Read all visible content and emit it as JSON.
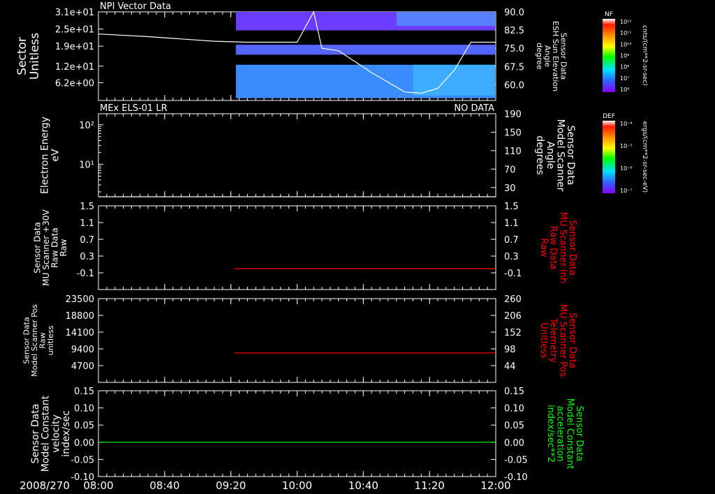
{
  "theme": {
    "background": "#000000",
    "axis_color": "#ffffff",
    "trace_white": "#ffffff",
    "trace_red": "#ff0000",
    "trace_green": "#00ff00"
  },
  "time_axis": {
    "date_label": "2008/270",
    "start": "08:00",
    "end": "12:00",
    "tick_labels": [
      "08:00",
      "08:40",
      "09:20",
      "10:00",
      "10:40",
      "11:20",
      "12:00"
    ]
  },
  "colorbars": [
    {
      "title": "NF",
      "units": "cnts/(cm**2-sr-sec)",
      "tick_labels": [
        "10¹²",
        "10¹¹",
        "10¹⁰",
        "10⁹",
        "10⁸",
        "10⁷",
        "10⁶"
      ]
    },
    {
      "title": "DEF",
      "units": "ergs/(cm**2-sr-sec-eV)",
      "tick_labels": [
        "10⁻⁴",
        "10⁻⁵",
        "10⁻⁶",
        "10⁻⁷"
      ]
    }
  ],
  "chart_data": [
    {
      "type": "heatmap",
      "title": "NPI Vector Data",
      "status": "",
      "ylabel": [
        "Sector",
        "Unitless"
      ],
      "ytick_labels": [
        "3.1e+01",
        "2.5e+01",
        "1.9e+01",
        "1.2e+01",
        "6.2e+00"
      ],
      "ylim": [
        0,
        31
      ],
      "data_start": "09:23",
      "notes_bands": "spectrogram bands (sector ranges) with NF counts",
      "bands": [
        {
          "sector": [
            24.5,
            31.0
          ],
          "level": "medium",
          "color": "#6a3cff"
        },
        {
          "sector": [
            19.5,
            24.5
          ],
          "level": "gap",
          "color": "#000000"
        },
        {
          "sector": [
            16.0,
            19.5
          ],
          "level": "medium",
          "color": "#5566ff"
        },
        {
          "sector": [
            12.5,
            16.0
          ],
          "level": "gap",
          "color": "#000000"
        },
        {
          "sector": [
            0.8,
            12.5
          ],
          "level": "medium-high",
          "color": "#3a8cff"
        }
      ],
      "right_axis": {
        "label": [
          "Sensor Data",
          "ESH Sun Elevation",
          "Angle",
          "degree"
        ],
        "tick_labels": [
          "90.0",
          "82.5",
          "75.0",
          "67.5",
          "60.0"
        ],
        "ylim": [
          53.5,
          90.0
        ]
      },
      "series": [
        {
          "name": "ESH Sun Elevation Angle",
          "axis": "right",
          "color": "#ffffff",
          "x": [
            "08:00",
            "08:30",
            "09:10",
            "09:30",
            "10:00",
            "10:10",
            "10:15",
            "10:25",
            "10:45",
            "11:05",
            "11:15",
            "11:25",
            "11:35",
            "11:45",
            "12:00"
          ],
          "y": [
            80.9,
            79.8,
            77.9,
            77.5,
            77.5,
            90.0,
            75.0,
            74.0,
            65.0,
            57.0,
            56.5,
            58.5,
            66.0,
            77.5,
            77.5
          ]
        }
      ]
    },
    {
      "type": "line",
      "title": "MEx ELS-01 LR",
      "status": "NO DATA",
      "ylabel": [
        "Electron Energy",
        "eV"
      ],
      "yscale": "log",
      "ytick_labels": [
        "10²",
        "10¹"
      ],
      "ylim": [
        1.5,
        190
      ],
      "right_axis": {
        "label": [
          "Sensor Data",
          "Model Scanner",
          "Angle",
          "degrees"
        ],
        "tick_labels": [
          "190",
          "150",
          "110",
          "70",
          "30"
        ],
        "ylim": [
          10,
          190
        ]
      },
      "series": [
        {
          "name": "Model Scanner Angle",
          "axis": "right",
          "color": "#ffffff",
          "x": [
            "08:00",
            "12:00"
          ],
          "y": [
            10,
            10
          ]
        }
      ]
    },
    {
      "type": "line",
      "title": "",
      "status": "",
      "ylabel": [
        "Sensor Data",
        "MU Scanner +30V",
        "Raw Data",
        "Raw"
      ],
      "ytick_labels": [
        "1.5",
        "1.1",
        "0.7",
        "0.3",
        "-0.1"
      ],
      "ylim": [
        -0.5,
        1.5
      ],
      "right_axis": {
        "label": [
          "Sensor Data",
          "MU Scanner Inh",
          "Raw Data",
          "Raw"
        ],
        "label_color": "#ff0000",
        "tick_labels": [
          "1.5",
          "1.1",
          "0.7",
          "0.3",
          "-0.1"
        ],
        "ylim": [
          -0.5,
          1.5
        ]
      },
      "series": [
        {
          "name": "MU Scanner Inh Raw Data",
          "axis": "right",
          "color": "#ff0000",
          "x": [
            "09:22",
            "12:00"
          ],
          "y": [
            0.0,
            0.0
          ]
        }
      ]
    },
    {
      "type": "line",
      "title": "",
      "status": "",
      "ylabel": [
        "Sensor Data",
        "Model Scanner Pos",
        "Raw",
        "unitless"
      ],
      "ytick_labels": [
        "23500",
        "18800",
        "14100",
        "9400",
        "4700"
      ],
      "ylim": [
        0,
        23500
      ],
      "right_axis": {
        "label": [
          "Sensor Data",
          "MU Scanner Pos",
          "Telemetry",
          "Unitless"
        ],
        "label_color": "#ff0000",
        "tick_labels": [
          "260",
          "206",
          "152",
          "98",
          "44"
        ],
        "ylim": [
          -10,
          260
        ]
      },
      "series": [
        {
          "name": "MU Scanner Pos Telemetry",
          "axis": "right",
          "color": "#ff0000",
          "x": [
            "09:22",
            "12:00"
          ],
          "y": [
            85,
            85
          ]
        }
      ]
    },
    {
      "type": "line",
      "title": "",
      "status": "",
      "ylabel": [
        "Sensor Data",
        "Model Constant",
        "velocity",
        "index/sec"
      ],
      "ytick_labels": [
        "0.15",
        "0.10",
        "0.05",
        "0.00",
        "-0.05",
        "-0.10"
      ],
      "ylim": [
        -0.1,
        0.15
      ],
      "right_axis": {
        "label": [
          "Sensor Data",
          "Model Constant",
          "acceleration",
          "index/sec**2"
        ],
        "label_color": "#00ff00",
        "tick_labels": [
          "0.15",
          "0.10",
          "0.05",
          "0.00",
          "-0.05",
          "-0.10"
        ],
        "ylim": [
          -0.1,
          0.15
        ]
      },
      "series": [
        {
          "name": "Model Constant acceleration",
          "axis": "right",
          "color": "#00ff00",
          "x": [
            "08:00",
            "12:00"
          ],
          "y": [
            0.0,
            0.0
          ]
        }
      ]
    }
  ]
}
